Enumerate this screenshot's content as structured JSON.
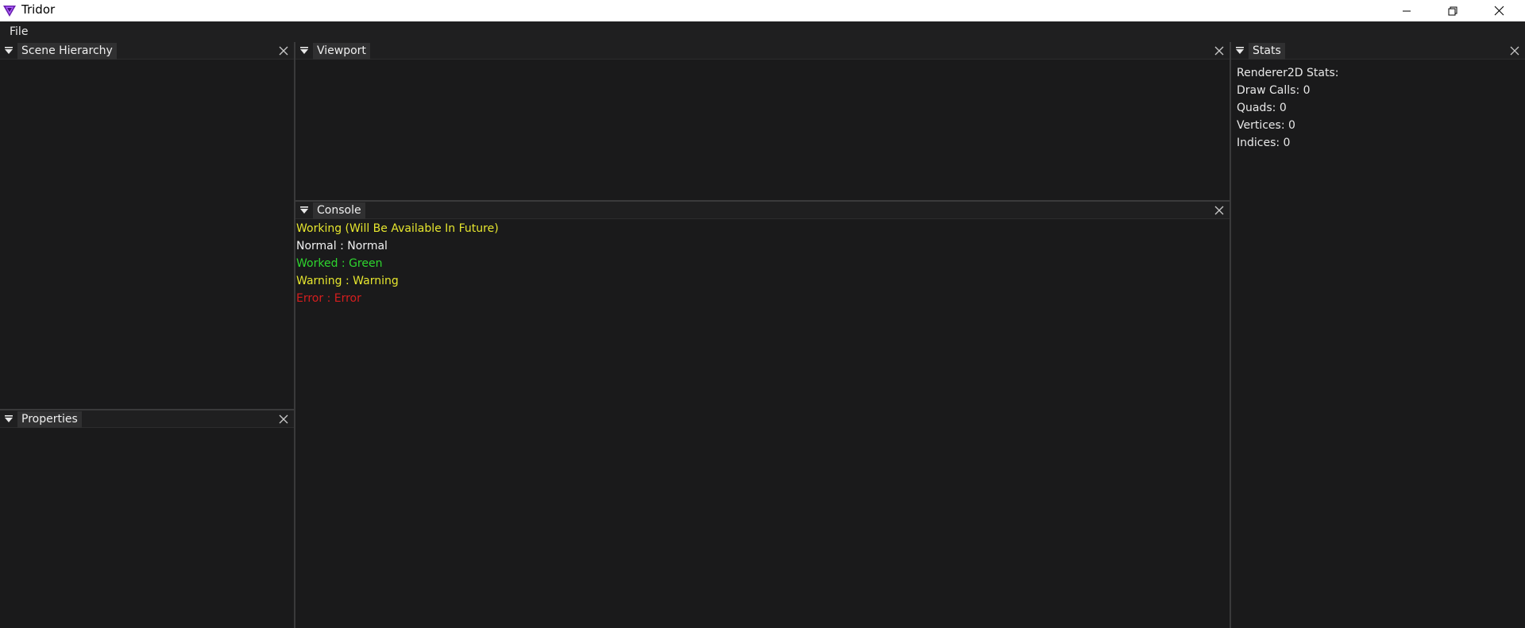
{
  "window": {
    "title": "Tridor",
    "controls": {
      "minimize_icon": "minimize-icon",
      "restore_icon": "restore-icon",
      "close_icon": "close-icon"
    }
  },
  "menubar": {
    "file_label": "File"
  },
  "panels": {
    "scene_hierarchy": {
      "title": "Scene Hierarchy"
    },
    "properties": {
      "title": "Properties"
    },
    "viewport": {
      "title": "Viewport"
    },
    "console": {
      "title": "Console",
      "lines": [
        {
          "text": "Working (Will Be Available In Future)",
          "color": "#e6e62e"
        },
        {
          "text": "Normal : Normal",
          "color": "#f2f2f2"
        },
        {
          "text": "Worked : Green",
          "color": "#2ed62e"
        },
        {
          "text": "Warning : Warning",
          "color": "#e6e62e"
        },
        {
          "text": "Error : Error",
          "color": "#d61e1e"
        }
      ]
    },
    "stats": {
      "title": "Stats",
      "lines": [
        "Renderer2D Stats:",
        "Draw Calls: 0",
        "Quads: 0",
        "Vertices: 0",
        "Indices: 0"
      ]
    }
  },
  "theme": {
    "background": "#1a1a1b",
    "header": "#1f1f20",
    "tab": "#303031",
    "logo_color": "#8a2be2"
  }
}
